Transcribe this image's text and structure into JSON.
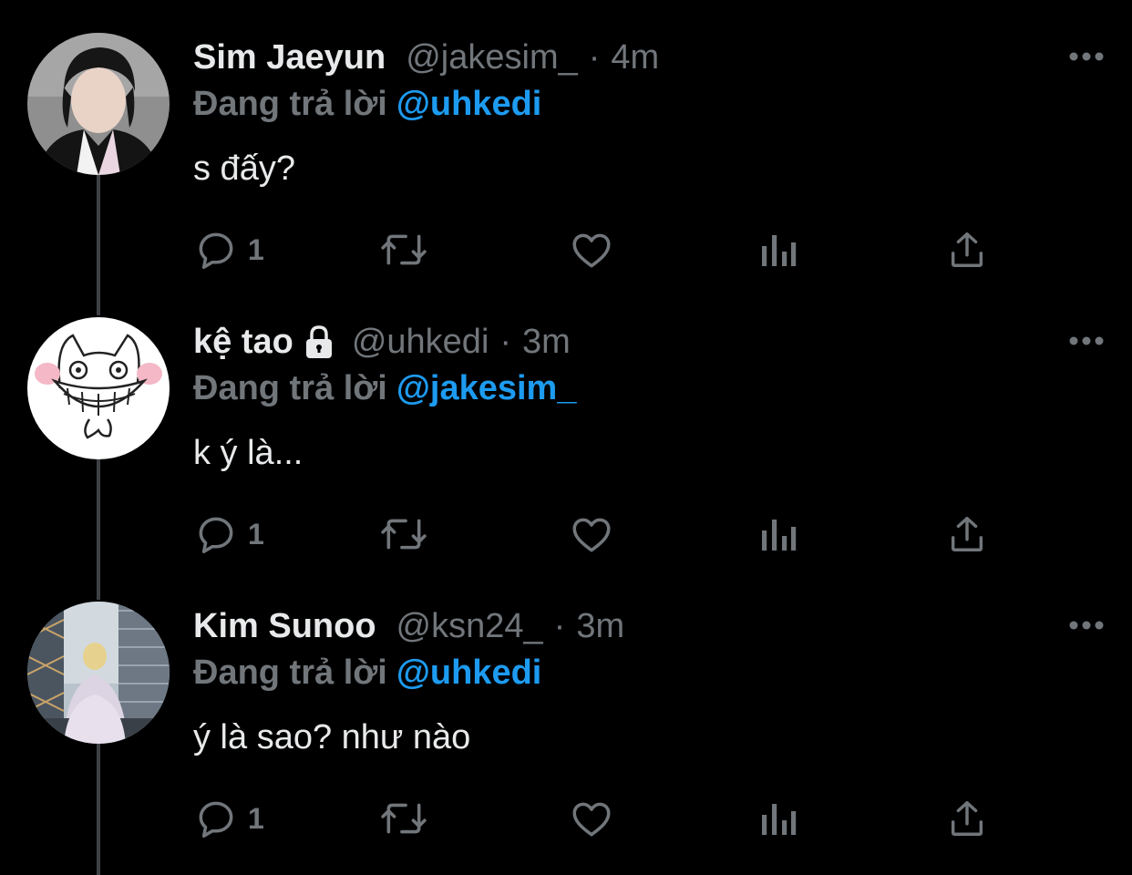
{
  "reply_prefix": "Đang trả lời",
  "colors": {
    "background": "#000000",
    "text_primary": "#e7e9ea",
    "text_secondary": "#71767b",
    "accent_blue": "#1d9bf0",
    "thread_line": "#3d4145"
  },
  "icons": {
    "more": "more-dots-icon",
    "reply": "reply-bubble-icon",
    "retweet": "retweet-icon",
    "like": "heart-icon",
    "views": "analytics-icon",
    "share": "share-icon",
    "protected": "lock-icon"
  },
  "tweets": [
    {
      "name": "Sim Jaeyun",
      "handle": "@jakesim_",
      "separator": "·",
      "time": "4m",
      "reply_to": "@uhkedi",
      "text": "s đấy?",
      "reply_count": "1",
      "locked": false
    },
    {
      "name": "kệ tao",
      "handle": "@uhkedi",
      "separator": "·",
      "time": "3m",
      "reply_to": "@jakesim_",
      "text": "k ý là...",
      "reply_count": "1",
      "locked": true
    },
    {
      "name": "Kim Sunoo",
      "handle": "@ksn24_",
      "separator": "·",
      "time": "3m",
      "reply_to": "@uhkedi",
      "text": "ý là sao? như nào",
      "reply_count": "1",
      "locked": false
    }
  ]
}
